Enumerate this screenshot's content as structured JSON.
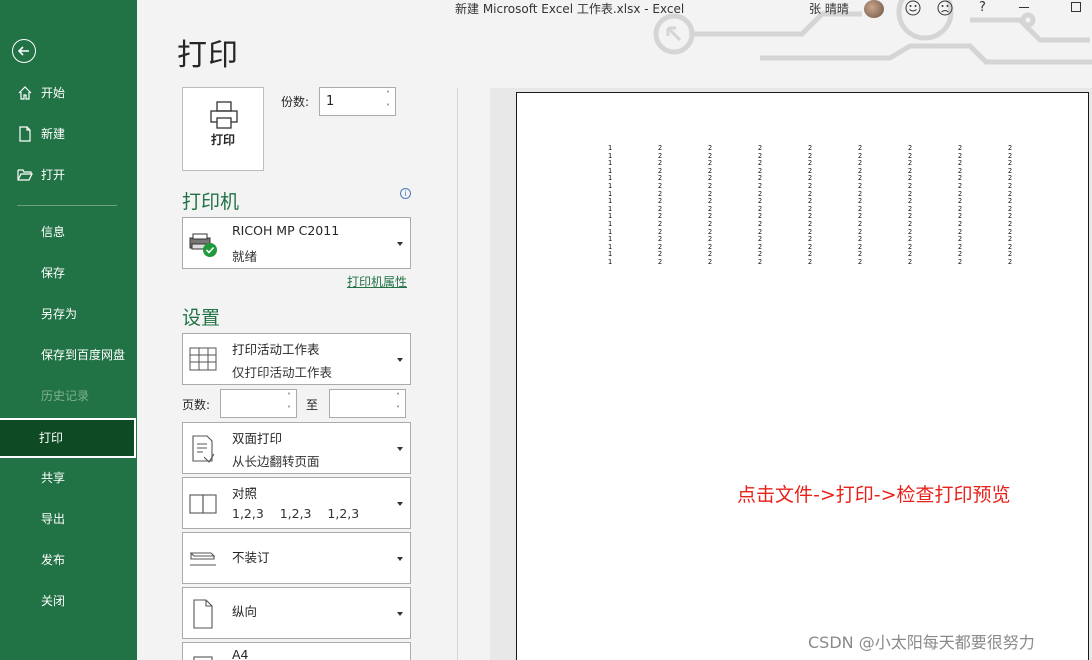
{
  "window": {
    "title": "新建 Microsoft Excel 工作表.xlsx  -  Excel",
    "user": "张 晴晴",
    "help": "?"
  },
  "sidebar": {
    "items": [
      {
        "label": "开始",
        "icon": "home-icon"
      },
      {
        "label": "新建",
        "icon": "new-document-icon"
      },
      {
        "label": "打开",
        "icon": "open-folder-icon"
      },
      {
        "label": "信息"
      },
      {
        "label": "保存"
      },
      {
        "label": "另存为"
      },
      {
        "label": "保存到百度网盘"
      },
      {
        "label": "历史记录",
        "disabled": true
      },
      {
        "label": "打印",
        "active": true
      },
      {
        "label": "共享"
      },
      {
        "label": "导出"
      },
      {
        "label": "发布"
      },
      {
        "label": "关闭"
      }
    ]
  },
  "print": {
    "heading": "打印",
    "button_label": "打印",
    "copies_label": "份数:",
    "copies_value": "1"
  },
  "printer": {
    "section_title": "打印机",
    "name": "RICOH MP C2011",
    "status": "就绪",
    "properties_link": "打印机属性"
  },
  "settings": {
    "section_title": "设置",
    "what": {
      "line1": "打印活动工作表",
      "line2": "仅打印活动工作表"
    },
    "pages_label": "页数:",
    "pages_from": "",
    "to_label": "至",
    "pages_to": "",
    "duplex": {
      "line1": "双面打印",
      "line2": "从长边翻转页面"
    },
    "collate": {
      "line1": "对照",
      "line2": "1,2,3    1,2,3    1,2,3"
    },
    "staple": {
      "label": "不装订"
    },
    "orientation": {
      "label": "纵向"
    },
    "paper": {
      "label": "A4"
    }
  },
  "preview": {
    "columns": [
      "1",
      "2",
      "2",
      "2",
      "2",
      "2",
      "2",
      "2",
      "2"
    ],
    "rows_per_column": 16,
    "annotation": "点击文件->打印->检查打印预览"
  },
  "watermark": "CSDN @小太阳每天都要很努力"
}
